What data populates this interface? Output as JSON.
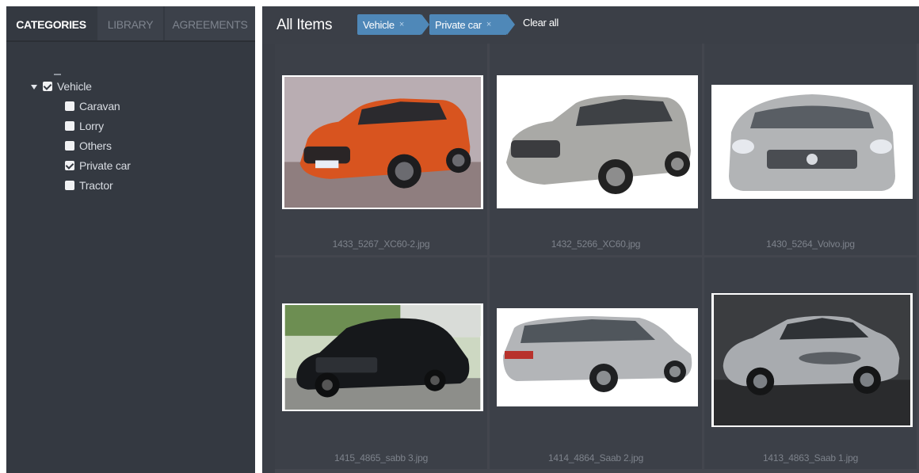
{
  "sidebar": {
    "tabs": [
      {
        "label": "CATEGORIES",
        "active": true
      },
      {
        "label": "LIBRARY",
        "active": false
      },
      {
        "label": "AGREEMENTS",
        "active": false
      }
    ],
    "tree": {
      "root": {
        "label": "Vehicle",
        "checked": true,
        "expanded": true
      },
      "children": [
        {
          "label": "Caravan",
          "checked": false
        },
        {
          "label": "Lorry",
          "checked": false
        },
        {
          "label": "Others",
          "checked": false
        },
        {
          "label": "Private car",
          "checked": true
        },
        {
          "label": "Tractor",
          "checked": false
        }
      ]
    }
  },
  "main": {
    "title": "All Items",
    "filters": [
      {
        "label": "Vehicle",
        "remove": "×"
      },
      {
        "label": "Private car",
        "remove": "×"
      }
    ],
    "clear_all": "Clear all",
    "items": [
      {
        "filename": "1433_5267_XC60-2.jpg",
        "subject": "orange-volvo-xc60"
      },
      {
        "filename": "1432_5266_XC60.jpg",
        "subject": "silver-volvo-xc60"
      },
      {
        "filename": "1430_5264_Volvo.jpg",
        "subject": "silver-volvo-front"
      },
      {
        "filename": "1415_4865_sabb 3.jpg",
        "subject": "black-classic-saab"
      },
      {
        "filename": "1414_4864_Saab 2.jpg",
        "subject": "silver-saab-wagon"
      },
      {
        "filename": "1413_4863_Saab 1.jpg",
        "subject": "silver-saab-sedan"
      }
    ]
  },
  "colors": {
    "sidebar_bg": "#343941",
    "main_bg": "#3a3e46",
    "chip_bg": "#4f88b8",
    "text_primary": "#ffffff",
    "text_muted": "#7d828b"
  }
}
